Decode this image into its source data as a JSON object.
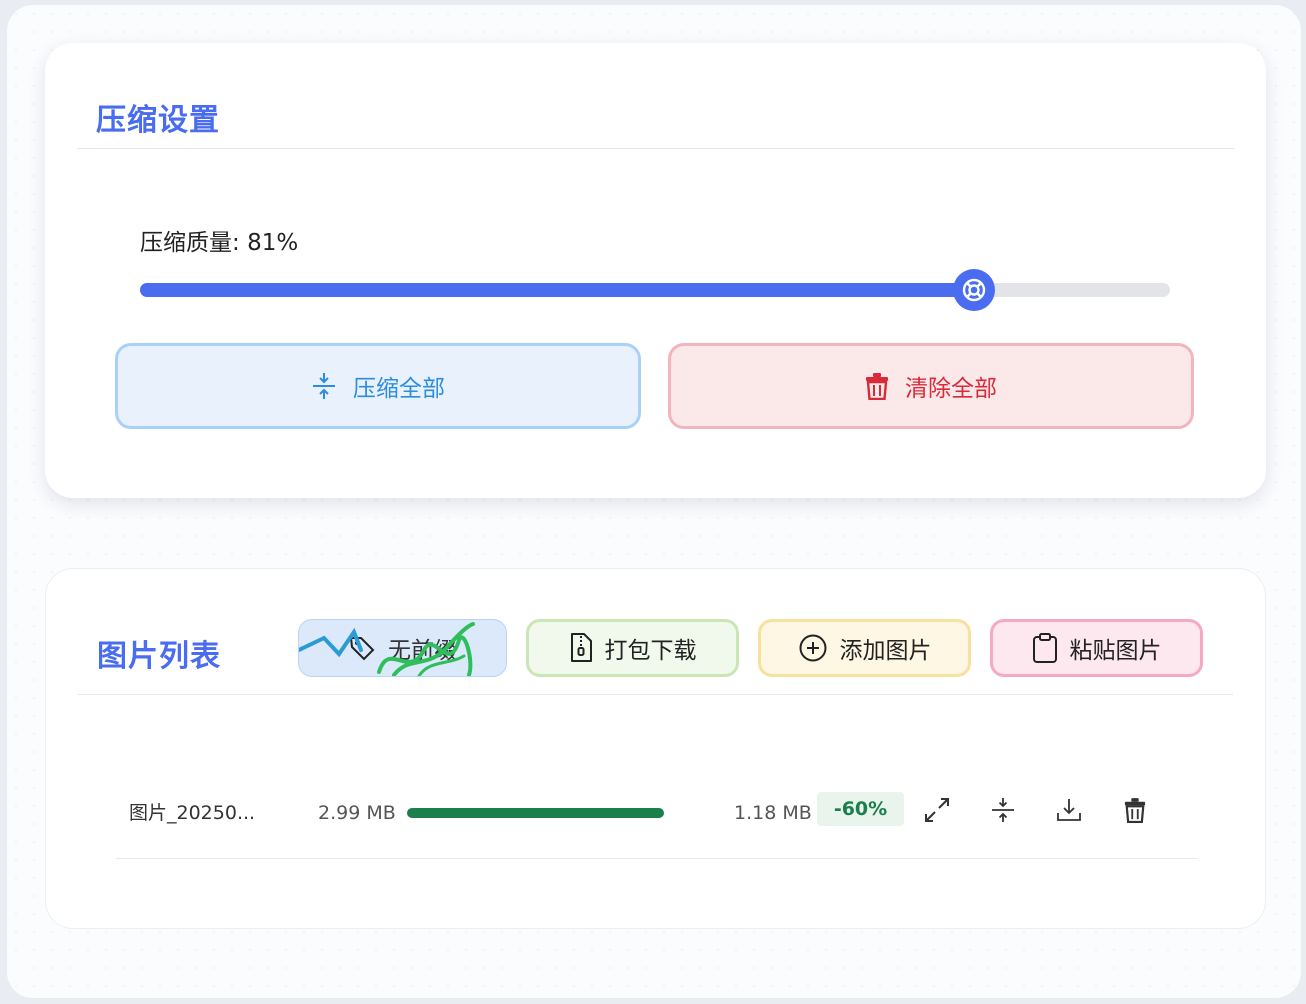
{
  "settings": {
    "title": "压缩设置",
    "quality_label": "压缩质量",
    "quality_value": "81%",
    "quality_fraction": 0.81,
    "compress_all_label": "压缩全部",
    "clear_all_label": "清除全部"
  },
  "list": {
    "title": "图片列表",
    "prefix_label": "无前缀",
    "zip_label": "打包下载",
    "add_label": "添加图片",
    "paste_label": "粘贴图片",
    "items": [
      {
        "name": "图片_20250...",
        "original_size": "2.99 MB",
        "progress": 1.0,
        "compressed_size": "1.18 MB",
        "ratio": "-60%"
      }
    ]
  },
  "colors": {
    "accent": "#4a6cf0",
    "compress_blue": "#2c8de0",
    "danger_red": "#d92a3a",
    "success_green": "#1a7f4b"
  },
  "icons": {
    "compress": "compress-icon",
    "trash": "trash-icon",
    "tag": "tag-icon",
    "zip": "zip-file-icon",
    "add": "plus-circle-icon",
    "paste": "clipboard-icon",
    "expand": "expand-icon",
    "download": "download-icon"
  }
}
